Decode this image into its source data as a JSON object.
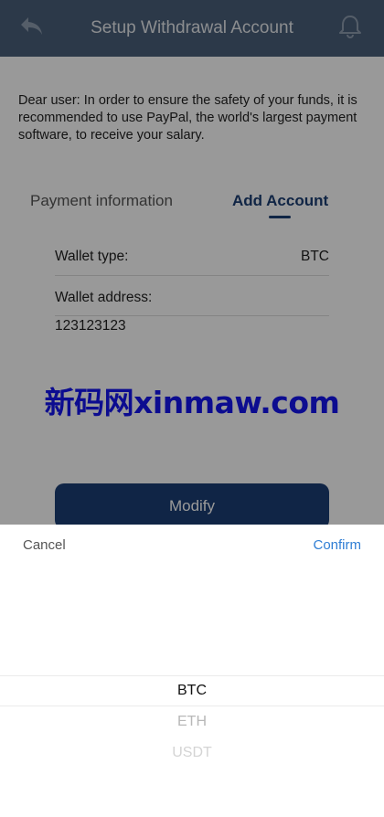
{
  "header": {
    "title": "Setup Withdrawal Account",
    "back_icon": "back-arrow-icon",
    "bell_icon": "bell-icon"
  },
  "notice": "Dear user: In order to ensure the safety of your funds, it is recommended to use PayPal, the world's largest payment software, to receive your salary.",
  "tabs": [
    {
      "label": "Payment information",
      "active": false
    },
    {
      "label": "Add Account",
      "active": true
    }
  ],
  "form": {
    "wallet_type_label": "Wallet type:",
    "wallet_type_value": "BTC",
    "wallet_address_label": "Wallet address:",
    "wallet_address_value": "123123123"
  },
  "watermark": "新码网xinmaw.com",
  "modify_label": "Modify",
  "picker": {
    "cancel_label": "Cancel",
    "confirm_label": "Confirm",
    "options": [
      "BTC",
      "ETH",
      "USDT"
    ],
    "selected": "BTC"
  },
  "colors": {
    "header_bg": "#4a5f7b",
    "accent": "#1c3e74",
    "confirm": "#2f7ed4",
    "watermark": "#1414f0"
  }
}
